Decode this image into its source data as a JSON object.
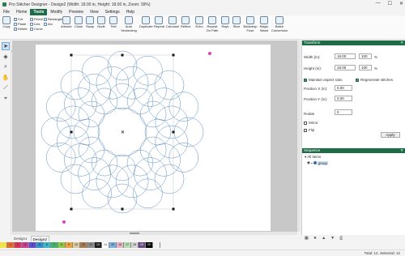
{
  "window": {
    "title": "Pro Stitcher Designer - Design2 (Width: 18.00 in, Height: 18.00 in, Zoom: 39%)",
    "minimize": "—",
    "maximize": "☐",
    "close": "✕"
  },
  "menu": [
    "File",
    "Home",
    "Tools",
    "Modify",
    "Preview",
    "View",
    "Settings",
    "Help"
  ],
  "menu_active": "Tools",
  "ribbon": {
    "copy": "Copy",
    "cut": "Cut",
    "paste": "Paste",
    "delete": "Delete",
    "pencil": "Pencil",
    "line": "Line",
    "curve": "Curve",
    "rectangle": "Rectangle",
    "arc": "Arc",
    "artwork": "Artwork",
    "close": "Close",
    "swap": "Swap",
    "node": "Node",
    "text": "Text",
    "auto_vectorizing": "Auto Vectorizing",
    "duplicate": "Duplicate",
    "repeat": "Repeat",
    "carousel": "Carousel",
    "reflect": "Reflect",
    "echo": "Echo",
    "repeat_on_path": "Repeat On Path",
    "rays": "Rays",
    "slice": "Slice",
    "backdrop": "Backdrop Fuse",
    "magic_wand": "Magic Wand",
    "batch_conversion": "Batch Conversion",
    "groups": [
      "Clipboard",
      "Draw",
      "Shapes",
      "Outlines",
      "Nodes",
      "Create",
      "Quilting",
      "Change",
      "Backdrop",
      "Other"
    ]
  },
  "tools": [
    "select-arrow",
    "node-edit",
    "zoom",
    "pan",
    "measure",
    "text"
  ],
  "transform": {
    "title": "Transform",
    "width_label": "Width (in):",
    "width_value": "18.00",
    "width_pct": "100",
    "height_label": "Height (in):",
    "height_value": "18.00",
    "height_pct": "100",
    "pct": "%",
    "maintain_aspect": "Maintain aspect ratio",
    "regenerate": "Regenerate stitches",
    "posx_label": "Position X (in):",
    "posx_value": "0.00",
    "posy_label": "Position Y (in):",
    "posy_value": "0.00",
    "rotate_label": "Rotate",
    "rotate_value": "0",
    "mirror": "Mirror",
    "flip": "Flip",
    "apply": "Apply"
  },
  "sequence": {
    "title": "Sequence",
    "all_items": "All items",
    "group": "group"
  },
  "tabs": [
    "Design1",
    "Design2"
  ],
  "tab_active": "Design2",
  "palette": [
    {
      "label": "",
      "color": "#f2e24a"
    },
    {
      "label": "1",
      "color": "#e86a2a"
    },
    {
      "label": "2",
      "color": "#d8335b"
    },
    {
      "label": "3",
      "color": "#c93d93"
    },
    {
      "label": "4",
      "color": "#5a4fcf"
    },
    {
      "label": "5",
      "color": "#2d8fd6"
    },
    {
      "label": "6",
      "color": "#3cb6c9"
    },
    {
      "label": "7",
      "color": "#41b36a"
    },
    {
      "label": "8",
      "color": "#8fc94a"
    },
    {
      "label": "9",
      "color": "#f0a33b"
    },
    {
      "label": "10",
      "color": "#d9c9a0"
    },
    {
      "label": "11",
      "color": "#a87b50"
    },
    {
      "label": "12",
      "color": "#8a8a8a"
    },
    {
      "label": "13",
      "color": "#1e1e1e"
    },
    {
      "label": "14",
      "color": "#ffffff"
    },
    {
      "label": "15",
      "color": "#7ab0e0"
    },
    {
      "label": "16",
      "color": "#e8b3c8"
    },
    {
      "label": "17",
      "color": "#b4e0b0"
    },
    {
      "label": "18",
      "color": "#d4d4d4"
    },
    {
      "label": "19",
      "color": "#6c4a8a"
    },
    {
      "label": "20",
      "color": "#000000"
    },
    {
      "label": "",
      "color": "#f3f3f3"
    }
  ],
  "status": "Total: 12, Selected: 12",
  "colors": {
    "accent": "#1e6b47",
    "stitch": "#5b8fc4"
  }
}
